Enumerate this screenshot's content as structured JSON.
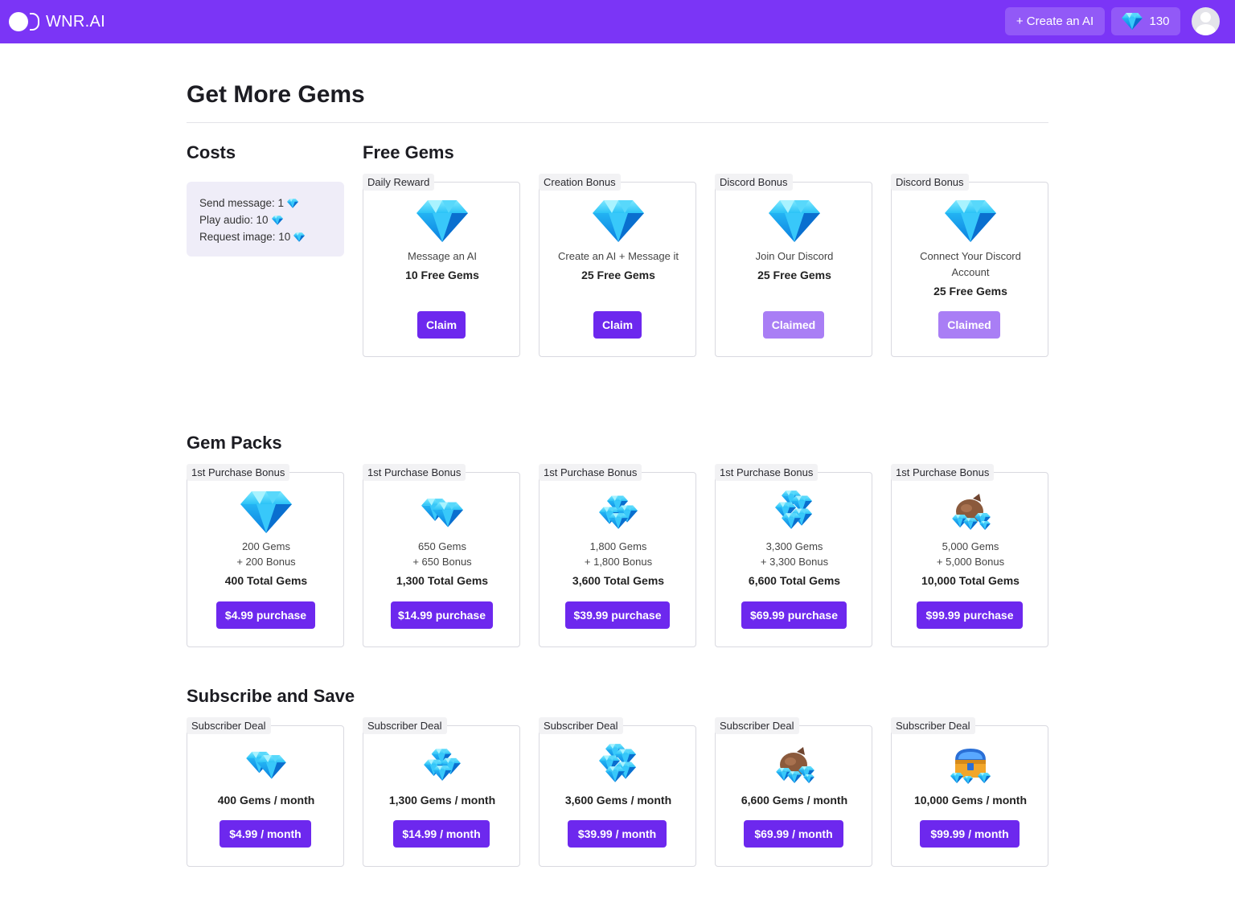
{
  "header": {
    "logo_text": "WNR.AI",
    "create_label": "+ Create an AI",
    "gem_count": "130",
    "accent": "#7b35f6"
  },
  "page": {
    "title": "Get More Gems"
  },
  "costs": {
    "title": "Costs",
    "lines": [
      "Send message: 1",
      "Play audio: 10",
      "Request image: 10"
    ]
  },
  "free_gems": {
    "title": "Free Gems",
    "cards": [
      {
        "tag": "Daily Reward",
        "desc": "Message an AI",
        "desc2": "",
        "amount": "10 Free Gems",
        "button": "Claim",
        "state": "available"
      },
      {
        "tag": "Creation Bonus",
        "desc": "Create an AI + Message it",
        "desc2": "",
        "amount": "25 Free Gems",
        "button": "Claim",
        "state": "available"
      },
      {
        "tag": "Discord Bonus",
        "desc": "Join Our Discord",
        "desc2": "",
        "amount": "25 Free Gems",
        "button": "Claimed",
        "state": "claimed"
      },
      {
        "tag": "Discord Bonus",
        "desc": "Connect Your Discord",
        "desc2": "Account",
        "amount": "25 Free Gems",
        "button": "Claimed",
        "state": "claimed"
      }
    ]
  },
  "gem_packs": {
    "title": "Gem Packs",
    "cards": [
      {
        "tag": "1st Purchase Bonus",
        "icon": "single-gem-icon",
        "gems": "200 Gems",
        "bonus": "+ 200 Bonus",
        "total": "400 Total Gems",
        "button": "$4.99 purchase"
      },
      {
        "tag": "1st Purchase Bonus",
        "icon": "gem-pair-icon",
        "gems": "650 Gems",
        "bonus": "+ 650 Bonus",
        "total": "1,300 Total Gems",
        "button": "$14.99 purchase"
      },
      {
        "tag": "1st Purchase Bonus",
        "icon": "gem-pile-icon",
        "gems": "1,800 Gems",
        "bonus": "+ 1,800 Bonus",
        "total": "3,600 Total Gems",
        "button": "$39.99 purchase"
      },
      {
        "tag": "1st Purchase Bonus",
        "icon": "gem-heap-icon",
        "gems": "3,300 Gems",
        "bonus": "+ 3,300 Bonus",
        "total": "6,600 Total Gems",
        "button": "$69.99 purchase"
      },
      {
        "tag": "1st Purchase Bonus",
        "icon": "gem-sack-icon",
        "gems": "5,000 Gems",
        "bonus": "+ 5,000 Bonus",
        "total": "10,000 Total Gems",
        "button": "$99.99 purchase"
      }
    ]
  },
  "subscriptions": {
    "title": "Subscribe and Save",
    "cards": [
      {
        "tag": "Subscriber Deal",
        "icon": "gem-pair-icon",
        "amount": "400 Gems / month",
        "button": "$4.99 / month"
      },
      {
        "tag": "Subscriber Deal",
        "icon": "gem-pile-icon",
        "amount": "1,300 Gems / month",
        "button": "$14.99 / month"
      },
      {
        "tag": "Subscriber Deal",
        "icon": "gem-heap-icon",
        "amount": "3,600 Gems / month",
        "button": "$39.99 / month"
      },
      {
        "tag": "Subscriber Deal",
        "icon": "gem-sack-icon",
        "amount": "6,600 Gems / month",
        "button": "$69.99 / month"
      },
      {
        "tag": "Subscriber Deal",
        "icon": "treasure-chest-icon",
        "amount": "10,000 Gems / month",
        "button": "$99.99 / month"
      }
    ]
  }
}
